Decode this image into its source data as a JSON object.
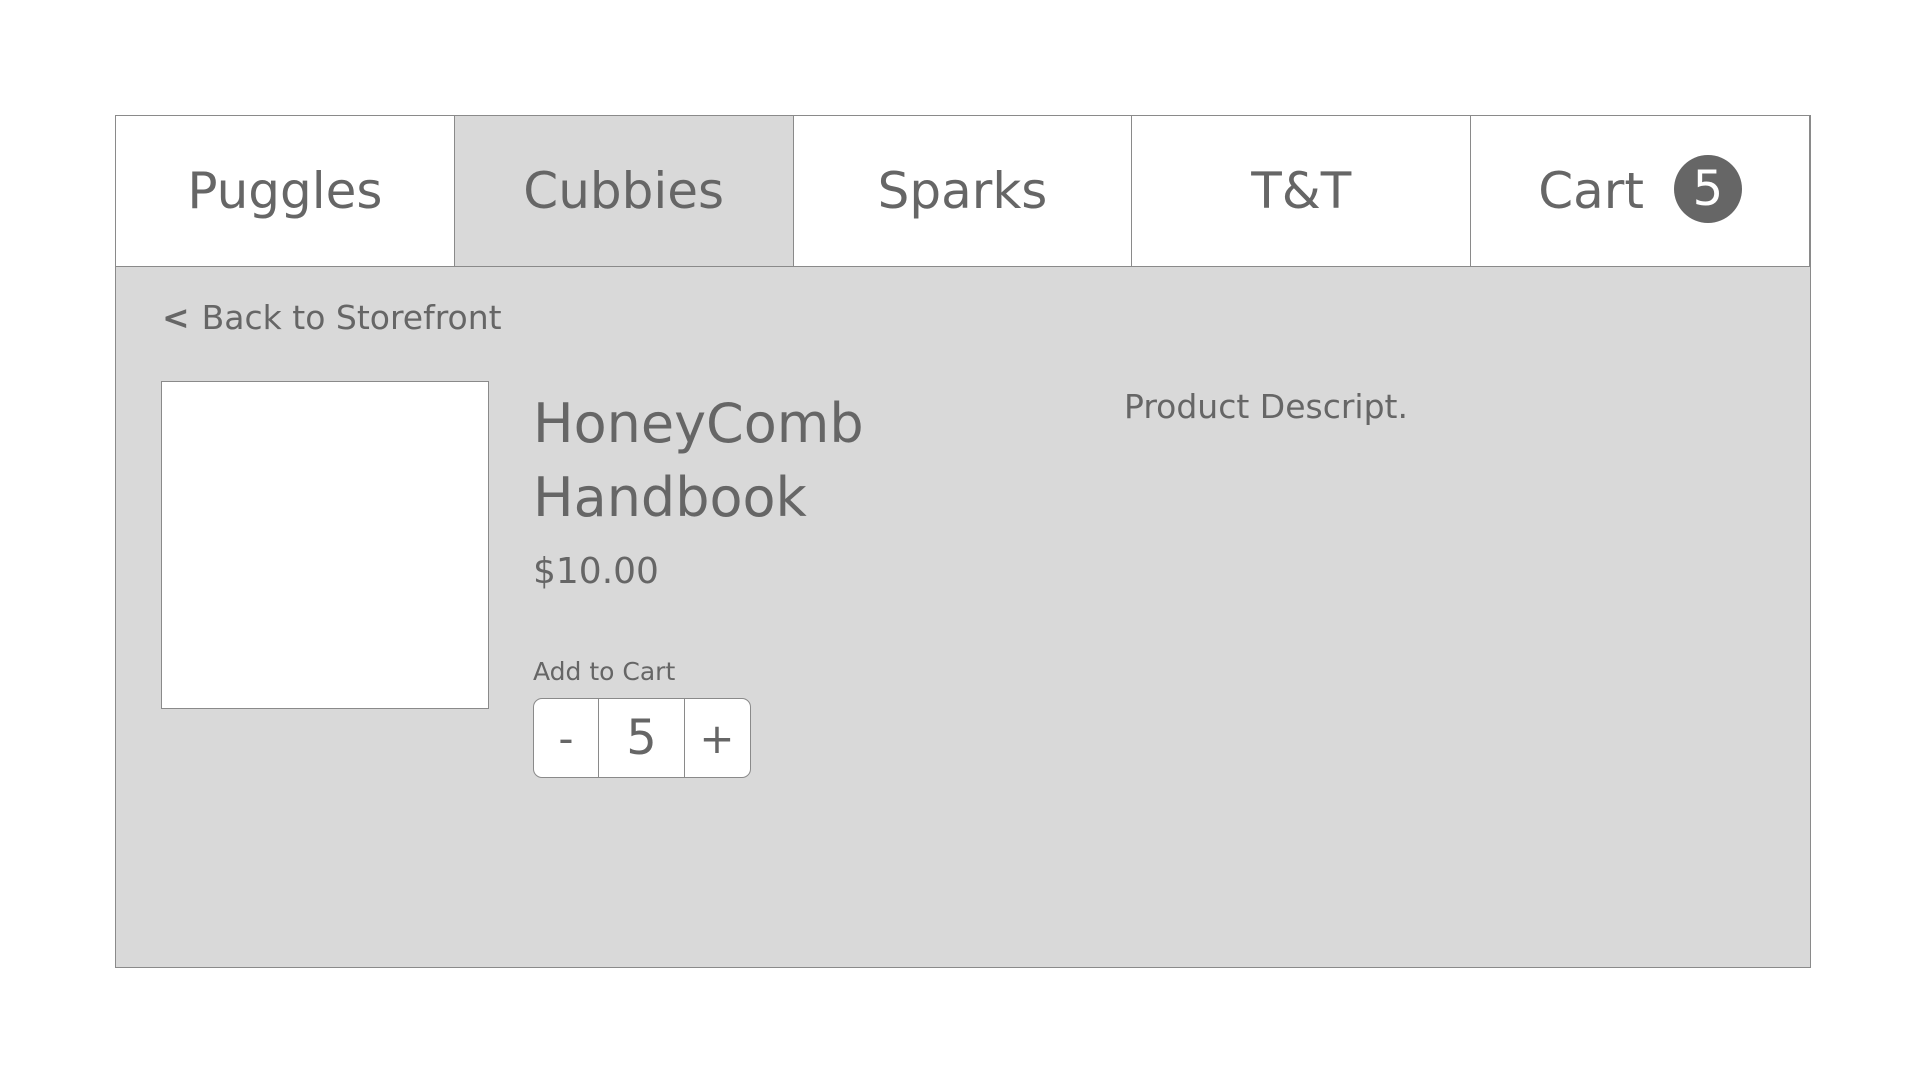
{
  "nav": {
    "tabs": [
      {
        "label": "Puggles",
        "active": false
      },
      {
        "label": "Cubbies",
        "active": true
      },
      {
        "label": "Sparks",
        "active": false
      },
      {
        "label": "T&T",
        "active": false
      },
      {
        "label": "Cart",
        "active": false
      }
    ],
    "cart_count": "5"
  },
  "back_link": {
    "chevron": "<",
    "label": "Back to Storefront"
  },
  "product": {
    "title": "HoneyComb Handbook",
    "price": "$10.00",
    "description": "Product Descript.",
    "add_to_cart_label": "Add to Cart",
    "quantity": "5",
    "decrement_label": "-",
    "increment_label": "+"
  },
  "colors": {
    "text": "#666666",
    "panel_bg": "#d9d9d9",
    "border": "#8a8a8a",
    "badge_bg": "#666666"
  }
}
